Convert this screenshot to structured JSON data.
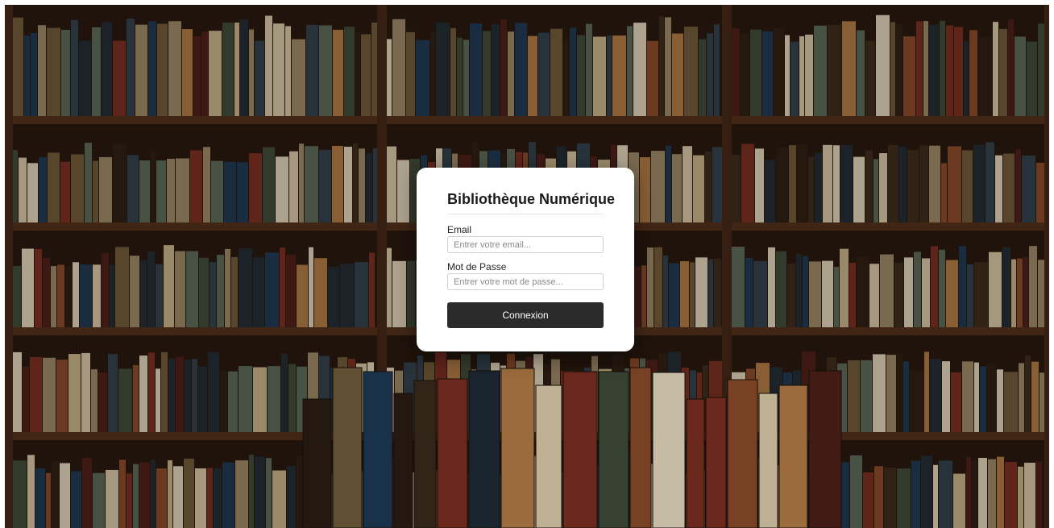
{
  "login": {
    "title": "Bibliothèque Numérique",
    "email_label": "Email",
    "email_placeholder": "Entrer votre email...",
    "password_label": "Mot de Passe",
    "password_placeholder": "Entrer votre mot de passe...",
    "submit_label": "Connexion"
  },
  "colors": {
    "card_background": "#ffffff",
    "button_background": "#2b2b2b",
    "button_text": "#ffffff",
    "shelf_wood": "#4a2c1a"
  },
  "background": {
    "description_icon": "bookshelf-photo"
  }
}
